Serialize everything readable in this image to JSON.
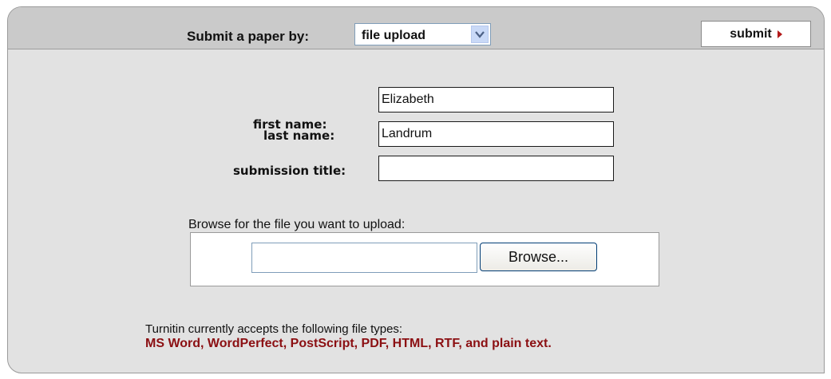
{
  "header": {
    "submit_by_label": "Submit a paper by:",
    "method_select": {
      "value": "file upload"
    },
    "submit_button": "submit"
  },
  "form": {
    "first_name": {
      "label": "first name:",
      "value": "Elizabeth"
    },
    "last_name": {
      "label": "last name:",
      "value": "Landrum"
    },
    "submission_title": {
      "label": "submission title:",
      "value": ""
    }
  },
  "upload": {
    "prompt": "Browse for the file you want to upload:",
    "file_value": "",
    "browse_button": "Browse..."
  },
  "file_types": {
    "intro": "Turnitin currently accepts the following file types:",
    "list": "MS Word, WordPerfect, PostScript, PDF, HTML, RTF, and plain text."
  },
  "colors": {
    "panel_bg": "#e2e2e2",
    "header_bg": "#cacaca",
    "file_types_text": "#8b0f12",
    "submit_arrow": "#b31919"
  },
  "icons": {
    "select_arrow": "chevron-down-icon",
    "submit_arrow": "play-arrow-icon"
  }
}
